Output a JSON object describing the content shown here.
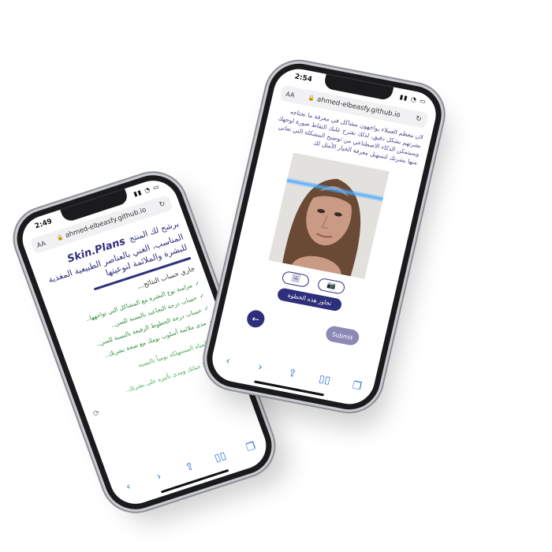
{
  "left_phone": {
    "status": {
      "time": "2:49",
      "system": "▮▮ ◔ ▭"
    },
    "url": {
      "aa": "AA",
      "domain": "ahmed-elbeasfy.github.io",
      "lock": "🔒",
      "reload": "↻"
    },
    "header": {
      "prefix": "يرشح لك المنتج",
      "brand": "Skin.Plans",
      "headline": "المناسب، الغني بالعناصر الطبيعية المغذية للبشرة والملائمة لنوعيتها"
    },
    "calculating": "جاري حساب النتائج...",
    "steps": [
      {
        "text": "مزامنة نوع البشرة مع المشاكل التي تواجهها..",
        "done": true
      },
      {
        "text": "حساب درجة التجاعيد بالنسبة للسن..",
        "done": true
      },
      {
        "text": "حساب درجة الخطوط الرفيعة بالنسبة للسن..",
        "done": true
      },
      {
        "text": "مدى ملائمة أسلوب نومك مع صحة بشرتك..",
        "done": true
      },
      {
        "text": "كمية المياه المستهلكة يومياً بالنسبة",
        "done": false
      },
      {
        "text": "تحليل نمط حياتك ومدى تأثيره على بشرتك..",
        "done": false
      }
    ],
    "toolbar": [
      "‹",
      "›",
      "⇪",
      "▯▯",
      "❐"
    ]
  },
  "right_phone": {
    "status": {
      "time": "2:54",
      "system": "▮▮ ◔ ▭"
    },
    "url": {
      "aa": "AA",
      "domain": "ahmed-elbeasfy.github.io",
      "lock": "🔒",
      "reload": "↻"
    },
    "intro": "لان معظم العملاء يواجهون مشاكل في معرفة ما تحتاجه بشرتهم بشكل دقيق، لذلك نقترح عليك التقاط صورة لوجهك وسيتمكن الذكاء الاصطناعي من توضيح المشكلة التي تعاني منها بشرتك لتسهيل معرفة الخيار الأمثل لك",
    "upload_icon": "🖼",
    "camera_icon": "📷",
    "skip_label": "تجاوز هذه الخطوة",
    "back_label": "←",
    "submit_label": "Submit",
    "toolbar": [
      "‹",
      "›",
      "⇪",
      "▯▯",
      "❐"
    ]
  }
}
